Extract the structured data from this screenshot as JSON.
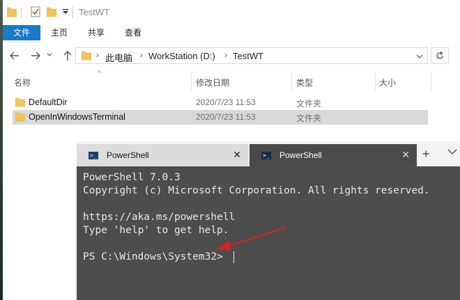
{
  "window": {
    "title": "TestWT"
  },
  "ribbon": {
    "tabs": [
      "文件",
      "主页",
      "共享",
      "查看"
    ]
  },
  "address": {
    "crumbs": [
      "此电脑",
      "WorkStation (D:)",
      "TestWT"
    ]
  },
  "columns": {
    "name": "名称",
    "date": "修改日期",
    "type": "类型",
    "size": "大小"
  },
  "files": [
    {
      "name": "DefaultDir",
      "date": "2020/7/23 11:53",
      "type": "文件夹",
      "selected": false
    },
    {
      "name": "OpenInWindowsTerminal",
      "date": "2020/7/23 11:53",
      "type": "文件夹",
      "selected": true
    }
  ],
  "terminal": {
    "tabs": [
      {
        "label": "PowerShell",
        "active": false
      },
      {
        "label": "PowerShell",
        "active": true
      }
    ],
    "lines": [
      "PowerShell 7.0.3",
      "Copyright (c) Microsoft Corporation. All rights reserved.",
      "",
      "https://aka.ms/powershell",
      "Type 'help' to get help.",
      "",
      "PS C:\\Windows\\System32> "
    ]
  },
  "colors": {
    "file_tab": "#1979ca",
    "folder": "#f2c55c",
    "annotation_arrow": "#e02020",
    "terminal_bg": "#4d4d4d"
  },
  "icons": {
    "folder": "folder-icon",
    "powershell": "powershell-icon",
    "back": "back-arrow-icon",
    "forward": "forward-arrow-icon",
    "up": "up-arrow-icon",
    "refresh": "refresh-icon"
  }
}
